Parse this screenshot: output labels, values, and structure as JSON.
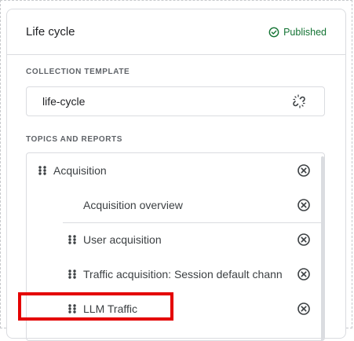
{
  "panel": {
    "title": "Life cycle",
    "status": "Published",
    "status_color": "#137333"
  },
  "collection_template": {
    "section_label": "COLLECTION TEMPLATE",
    "value": "life-cycle",
    "action_icon": "unlink-icon"
  },
  "topics": {
    "section_label": "TOPICS AND REPORTS",
    "items": [
      {
        "label": "Acquisition",
        "kind": "topic",
        "draggable": true
      },
      {
        "label": "Acquisition overview",
        "kind": "report",
        "draggable": false
      },
      {
        "label": "User acquisition",
        "kind": "report",
        "draggable": true
      },
      {
        "label": "Traffic acquisition: Session default channel group",
        "kind": "report",
        "draggable": true
      },
      {
        "label": "LLM Traffic",
        "kind": "report",
        "draggable": true,
        "highlighted": true
      }
    ]
  },
  "colors": {
    "highlight": "#e40000",
    "border": "#dadce0"
  }
}
